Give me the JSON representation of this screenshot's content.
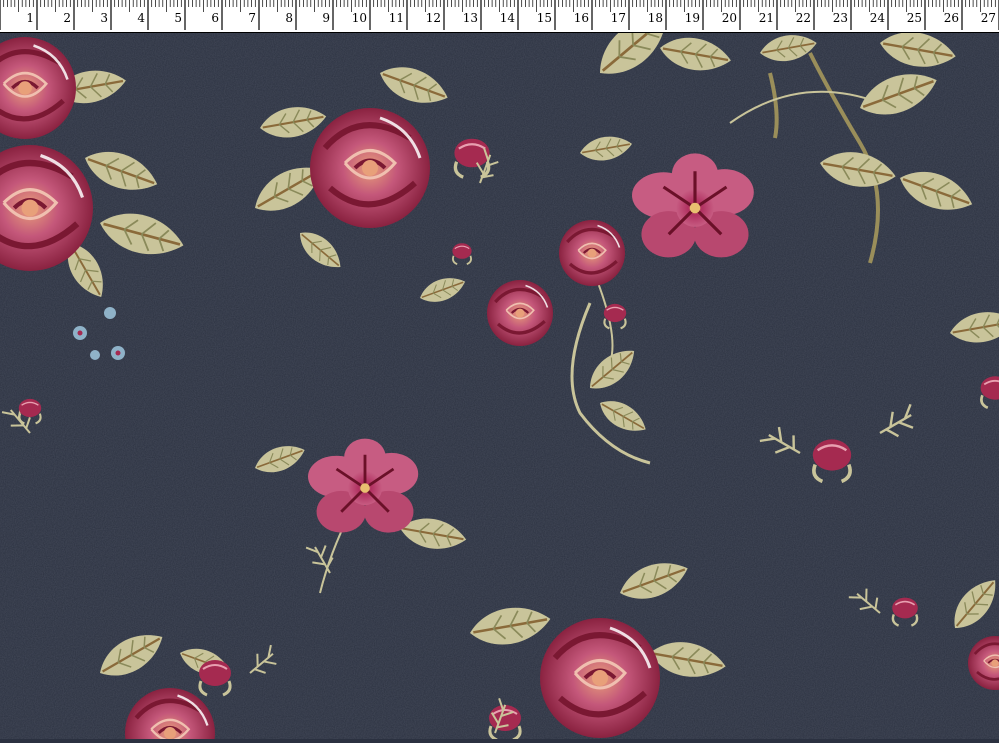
{
  "ruler": {
    "labels": [
      "1",
      "2",
      "3",
      "4",
      "5",
      "6",
      "7",
      "8",
      "9",
      "10",
      "11",
      "12",
      "13",
      "14",
      "15",
      "16",
      "17",
      "18",
      "19",
      "20",
      "21",
      "22",
      "23",
      "24",
      "25",
      "26",
      "27"
    ]
  },
  "colors": {
    "fabric": "#2b3140",
    "rose_pink": "#c4577a",
    "rose_dark": "#7a1832",
    "rose_peach": "#e8a07a",
    "leaf": "#c9c49a",
    "leaf_dark": "#8a8a5a",
    "stem": "#9a8e5a",
    "blue_flower": "#8fb2c8"
  },
  "image": {
    "subject": "dark navy knit fabric with floral print of pink roses, pansies, rosebuds and sage leaves",
    "icons": [
      "ruler-icon",
      "rose-icon",
      "pansy-icon",
      "rosebud-icon",
      "leaf-icon"
    ]
  }
}
